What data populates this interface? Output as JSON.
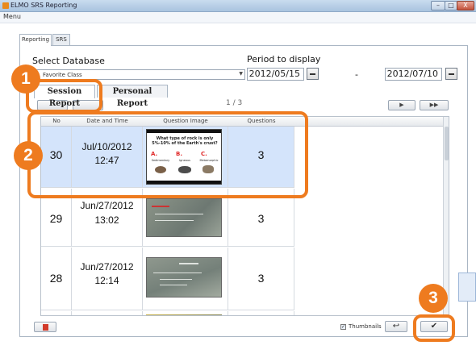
{
  "window": {
    "title": "ELMO SRS Reporting",
    "buttons": [
      "–",
      "□",
      "X"
    ]
  },
  "menu": {
    "label": "Menu"
  },
  "outer_tabs": [
    {
      "label": "Reporting",
      "active": true
    },
    {
      "label": "SRS",
      "active": false
    }
  ],
  "database": {
    "label": "Select Database",
    "selected": "Favorite Class"
  },
  "period": {
    "label": "Period to display",
    "start": "2012/05/15",
    "separator": "-",
    "end": "2012/07/10"
  },
  "inner_tabs": [
    {
      "label": "Session Report",
      "active": true
    },
    {
      "label": "Personal Report",
      "active": false
    }
  ],
  "pagination": {
    "page_indicator": "1 / 3",
    "next": "▶",
    "last": "▶▶"
  },
  "table": {
    "columns": [
      "No",
      "Date and Time",
      "Question Image",
      "Questions"
    ],
    "rows": [
      {
        "no": "30",
        "date": "Jul/10/2012",
        "time": "12:47",
        "questions": "3",
        "selected": true,
        "thumb_text": "What type of rock is only 5%-10% of the Earth's crust?",
        "thumb_labels": [
          "Sedimentary",
          "Igneous",
          "Metamorphic"
        ],
        "thumb_letters": [
          "A.",
          "B.",
          "C."
        ]
      },
      {
        "no": "29",
        "date": "Jun/27/2012",
        "time": "13:02",
        "questions": "3",
        "selected": false
      },
      {
        "no": "28",
        "date": "Jun/27/2012",
        "time": "12:14",
        "questions": "3",
        "selected": false
      }
    ]
  },
  "footer": {
    "thumbnails_label": "Thumbnails",
    "thumbnails_checked": true,
    "undo_symbol": "↩",
    "ok_symbol": "✔"
  },
  "callouts": [
    "1",
    "2",
    "3"
  ],
  "colors": {
    "accent": "#ee7b1f",
    "selected_row": "#d4e4fb"
  }
}
